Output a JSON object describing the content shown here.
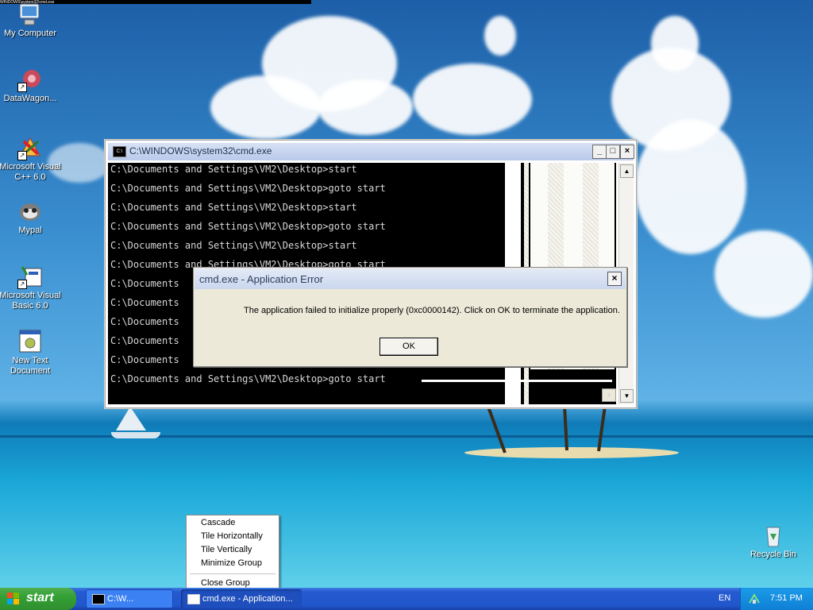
{
  "desktop": {
    "top_strip_text": "WINDOWS\\system32\\cmd.exe",
    "icons": [
      {
        "label": "My Computer",
        "icon": "my-computer-icon"
      },
      {
        "label": "DataWagon...",
        "icon": "datawagon-shortcut-icon"
      },
      {
        "label": "Microsoft Visual C++ 6.0",
        "icon": "visual-cpp-icon"
      },
      {
        "label": "Mypal",
        "icon": "mypal-browser-icon"
      },
      {
        "label": "Microsoft Visual Basic 6.0",
        "icon": "visual-basic-icon"
      },
      {
        "label": "New Text Document",
        "icon": "text-document-icon"
      },
      {
        "label": "Recycle Bin",
        "icon": "recycle-bin-icon"
      }
    ]
  },
  "cmd_window": {
    "title": "C:\\WINDOWS\\system32\\cmd.exe",
    "icon_text": "C:\\",
    "buttons": {
      "minimize": "_",
      "maximize": "□",
      "close": "×"
    },
    "lines": [
      "C:\\Documents and Settings\\VM2\\Desktop>start",
      "C:\\Documents and Settings\\VM2\\Desktop>goto start",
      "C:\\Documents and Settings\\VM2\\Desktop>start",
      "C:\\Documents and Settings\\VM2\\Desktop>goto start",
      "C:\\Documents and Settings\\VM2\\Desktop>start",
      "C:\\Documents and Settings\\VM2\\Desktop>goto start",
      "C:\\Documents",
      "C:\\Documents",
      "C:\\Documents",
      "C:\\Documents",
      "C:\\Documents",
      "C:\\Documents and Settings\\VM2\\Desktop>goto start"
    ]
  },
  "error_dialog": {
    "title": "cmd.exe - Application Error",
    "message": "The application failed to initialize properly (0xc0000142). Click on OK to terminate the application.",
    "ok_label": "OK",
    "close_label": "×"
  },
  "context_menu": {
    "items": [
      "Cascade",
      "Tile Horizontally",
      "Tile Vertically",
      "Minimize Group",
      "Close Group"
    ]
  },
  "taskbar": {
    "start_label": "start",
    "tasks": [
      "C:\\W...",
      "cmd.exe - Application..."
    ],
    "language": "EN",
    "clock": "7:51 PM"
  }
}
